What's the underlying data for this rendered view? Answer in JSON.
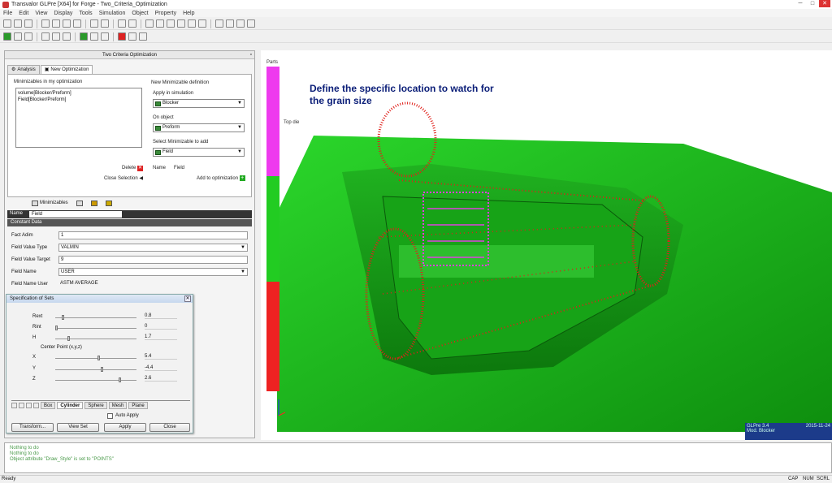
{
  "window": {
    "title": "Transvalor GLPre [X64] for Forge - Two_Criteria_Optimization"
  },
  "menu": [
    "File",
    "Edit",
    "View",
    "Display",
    "Tools",
    "Simulation",
    "Object",
    "Property",
    "Help"
  ],
  "panel": {
    "title": "Two Criteria Optimization",
    "tabs": [
      {
        "label": "Analysis",
        "icon": "analysis-icon"
      },
      {
        "label": "New Optimization",
        "icon": "optimization-icon"
      }
    ],
    "minimizables_label": "Minimizables in my optimization",
    "minimizables": [
      "volume[Blocker/Preform]",
      "Field[Blocker/Preform]"
    ],
    "new_def_label": "New Minimizable definition",
    "apply_in_sim_label": "Apply in simulation",
    "apply_in_sim_value": "Blocker",
    "on_object_label": "On object",
    "on_object_value": "Preform",
    "select_min_label": "Select Minimizable to add",
    "select_min_value": "Field",
    "name_label": "Name",
    "name_value": "Field",
    "delete_label": "Delete",
    "close_selection_label": "Close Selection",
    "add_label": "Add to optimization",
    "bottom_tab_label": "Minimizables"
  },
  "props": {
    "name_label": "Name",
    "name_value": "Field",
    "constant_data_label": "Constant Data",
    "fields": [
      {
        "label": "Fact Adim",
        "value": "1",
        "combo": false
      },
      {
        "label": "Field Value Type",
        "value": "VALMIN",
        "combo": true
      },
      {
        "label": "Field Value Target",
        "value": "9",
        "combo": false
      },
      {
        "label": "Field Name",
        "value": "USER",
        "combo": true
      },
      {
        "label": "Field Name User",
        "value": "ASTM AVERAGE",
        "combo": false
      }
    ]
  },
  "spec": {
    "title": "Specification of Sets",
    "rows": [
      {
        "label": "Rext",
        "value": "0.8"
      },
      {
        "label": "Rint",
        "value": "0"
      },
      {
        "label": "H",
        "value": "1.7"
      },
      {
        "label": "X",
        "value": "5.4"
      },
      {
        "label": "Y",
        "value": "-4.4"
      },
      {
        "label": "Z",
        "value": "2.6"
      }
    ],
    "center_label": "Center Point (x,y,z)",
    "tabs": [
      "Box",
      "Cylinder",
      "Sphere",
      "Mesh",
      "Plane"
    ],
    "active_tab": "Cylinder",
    "auto_apply_label": "Auto Apply",
    "buttons": {
      "transform": "Transform...",
      "view_set": "View Set",
      "apply": "Apply",
      "close": "Close"
    }
  },
  "viewport": {
    "parts_label": "Parts",
    "top_die_label": "Top die",
    "annotation": "Define the specific location to watch for the grain size",
    "info": {
      "version": "GLPre 3.4",
      "date": "2015-11-24",
      "model": "Mod. Blocker"
    },
    "colors": {
      "die": "#1bbf1b",
      "points": "#e0201a",
      "pink": "#e040e0",
      "bar_pink": "#ee3aee",
      "bar_green": "#22cc22",
      "bar_red": "#ee2222"
    }
  },
  "console": [
    "Nothing to do",
    "Nothing to do",
    "Object attribute \"Draw_Style\" is set to \"POINTS\""
  ],
  "status": {
    "ready": "Ready",
    "cap": "CAP",
    "num": "NUM",
    "scrl": "SCRL"
  }
}
